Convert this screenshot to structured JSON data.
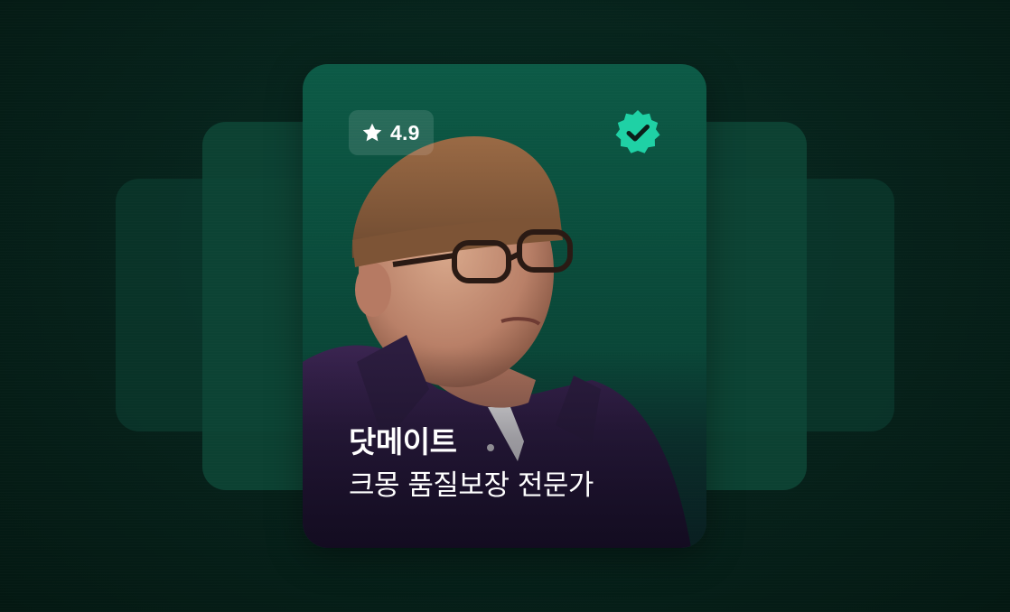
{
  "card": {
    "rating": "4.9",
    "name": "닷메이트",
    "title": "크몽 품질보장 전문가"
  },
  "icons": {
    "rating": "star-icon",
    "verified": "verified-badge-icon"
  },
  "colors": {
    "background": "#062019",
    "card": "#0a4a3a",
    "verified": "#1fd1a5",
    "text": "#ffffff"
  }
}
